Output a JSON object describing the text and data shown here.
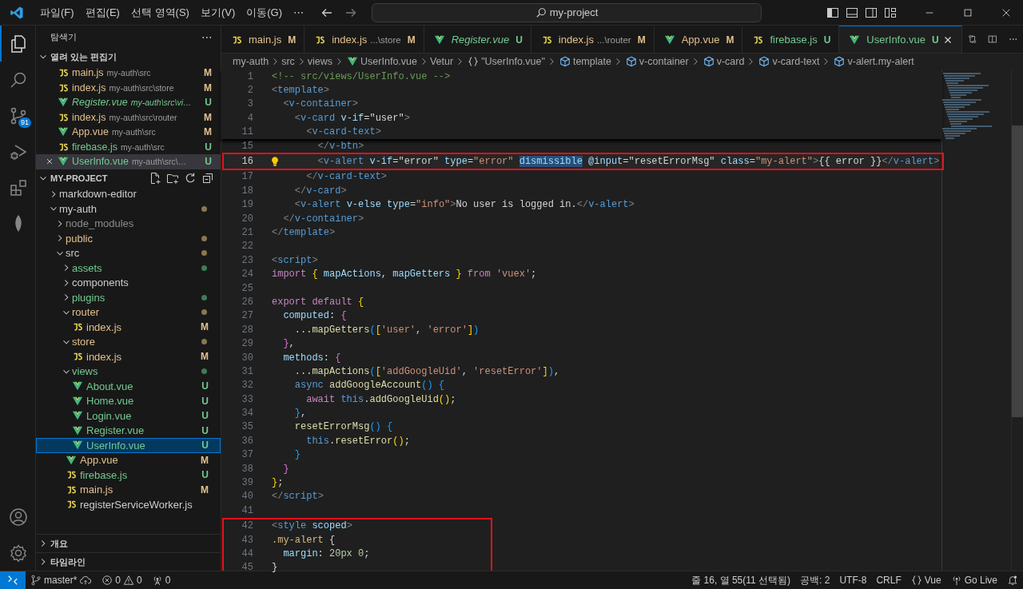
{
  "title_bar": {
    "menus": [
      "파일(F)",
      "편집(E)",
      "선택 영역(S)",
      "보기(V)",
      "이동(G)",
      "⋯"
    ],
    "search": "my-project"
  },
  "activity_bar": {
    "items": [
      {
        "kind": "files",
        "selected": true
      },
      {
        "kind": "search",
        "selected": false
      },
      {
        "kind": "scm",
        "selected": false,
        "badge": "91"
      },
      {
        "kind": "run",
        "selected": false
      },
      {
        "kind": "extensions",
        "selected": false
      },
      {
        "kind": "leaf",
        "selected": false
      }
    ]
  },
  "sidebar": {
    "title": "탐색기",
    "more": "⋯",
    "open_editors": {
      "title": "열려 있는 편집기",
      "expanded": true,
      "items": [
        {
          "name": "main.js",
          "path": "my-auth\\src",
          "kind": "js",
          "color": "#e2c08d",
          "status": "M",
          "preview": false,
          "selected": false
        },
        {
          "name": "index.js",
          "path": "my-auth\\src\\store",
          "kind": "js",
          "color": "#e2c08d",
          "status": "M",
          "preview": false,
          "selected": false
        },
        {
          "name": "Register.vue",
          "path": "my-auth\\src\\vi…",
          "kind": "vue",
          "color": "#73c991",
          "status": "U",
          "preview": true,
          "selected": false
        },
        {
          "name": "index.js",
          "path": "my-auth\\src\\router",
          "kind": "js",
          "color": "#e2c08d",
          "status": "M",
          "preview": false,
          "selected": false
        },
        {
          "name": "App.vue",
          "path": "my-auth\\src",
          "kind": "vue",
          "color": "#e2c08d",
          "status": "M",
          "preview": false,
          "selected": false
        },
        {
          "name": "firebase.js",
          "path": "my-auth\\src",
          "kind": "js",
          "color": "#73c991",
          "status": "U",
          "preview": false,
          "selected": false
        },
        {
          "name": "UserInfo.vue",
          "path": "my-auth\\src\\…",
          "kind": "vue",
          "color": "#73c991",
          "status": "U",
          "preview": false,
          "selected": true
        }
      ]
    },
    "project": {
      "title": "MY-PROJECT",
      "expanded": true,
      "items": [
        {
          "name": "markdown-editor",
          "kind": "folder",
          "expanded": false,
          "selected": false
        },
        {
          "name": "my-auth",
          "kind": "folder",
          "expanded": true,
          "selected": false,
          "dot": {
            "color": "#8a7650"
          },
          "children": [
            {
              "name": "node_modules",
              "kind": "folder",
              "color": "#8c8c8c",
              "expanded": false,
              "selected": false
            },
            {
              "name": "public",
              "kind": "folder",
              "color": "#e2c08d",
              "expanded": false,
              "selected": false,
              "dot": {
                "color": "#8a7650"
              }
            },
            {
              "name": "src",
              "kind": "folder",
              "expanded": true,
              "selected": false,
              "dot": {
                "color": "#8a7650"
              },
              "children": [
                {
                  "name": "assets",
                  "kind": "folder",
                  "color": "#73c991",
                  "expanded": false,
                  "selected": false,
                  "dot": {
                    "color": "#3f7a55"
                  }
                },
                {
                  "name": "components",
                  "kind": "folder",
                  "expanded": false,
                  "selected": false
                },
                {
                  "name": "plugins",
                  "kind": "folder",
                  "color": "#73c991",
                  "expanded": false,
                  "selected": false,
                  "dot": {
                    "color": "#3f7a55"
                  }
                },
                {
                  "name": "router",
                  "kind": "folder",
                  "color": "#e2c08d",
                  "expanded": true,
                  "selected": false,
                  "dot": {
                    "color": "#8a7650"
                  },
                  "children": [
                    {
                      "name": "index.js",
                      "kind": "js",
                      "color": "#e2c08d",
                      "status": "M",
                      "selected": false
                    }
                  ]
                },
                {
                  "name": "store",
                  "kind": "folder",
                  "color": "#e2c08d",
                  "expanded": true,
                  "selected": false,
                  "dot": {
                    "color": "#8a7650"
                  },
                  "children": [
                    {
                      "name": "index.js",
                      "kind": "js",
                      "color": "#e2c08d",
                      "status": "M",
                      "selected": false
                    }
                  ]
                },
                {
                  "name": "views",
                  "kind": "folder",
                  "color": "#73c991",
                  "expanded": true,
                  "selected": false,
                  "dot": {
                    "color": "#3f7a55"
                  },
                  "children": [
                    {
                      "name": "About.vue",
                      "kind": "vue",
                      "color": "#73c991",
                      "status": "U",
                      "selected": false
                    },
                    {
                      "name": "Home.vue",
                      "kind": "vue",
                      "color": "#73c991",
                      "status": "U",
                      "selected": false
                    },
                    {
                      "name": "Login.vue",
                      "kind": "vue",
                      "color": "#73c991",
                      "status": "U",
                      "selected": false
                    },
                    {
                      "name": "Register.vue",
                      "kind": "vue",
                      "color": "#73c991",
                      "status": "U",
                      "selected": false
                    },
                    {
                      "name": "UserInfo.vue",
                      "kind": "vue",
                      "color": "#73c991",
                      "status": "U",
                      "selected": true
                    }
                  ]
                },
                {
                  "name": "App.vue",
                  "kind": "vue",
                  "color": "#e2c08d",
                  "status": "M",
                  "selected": false
                },
                {
                  "name": "firebase.js",
                  "kind": "js",
                  "color": "#73c991",
                  "status": "U",
                  "selected": false
                },
                {
                  "name": "main.js",
                  "kind": "js",
                  "color": "#e2c08d",
                  "status": "M",
                  "selected": false
                },
                {
                  "name": "registerServiceWorker.js",
                  "kind": "js",
                  "selected": false
                }
              ]
            }
          ]
        }
      ]
    },
    "sections": [
      {
        "title": "개요",
        "expanded": false
      },
      {
        "title": "타임라인",
        "expanded": false
      }
    ]
  },
  "tabs": [
    {
      "name": "main.js",
      "kind": "js",
      "color": "#e2c08d",
      "status": "M",
      "preview": false,
      "selected": false
    },
    {
      "name": "index.js",
      "desc": "...\\store",
      "kind": "js",
      "color": "#e2c08d",
      "status": "M",
      "preview": false,
      "selected": false
    },
    {
      "name": "Register.vue",
      "kind": "vue",
      "color": "#73c991",
      "status": "U",
      "preview": true,
      "selected": false
    },
    {
      "name": "index.js",
      "desc": "...\\router",
      "kind": "js",
      "color": "#e2c08d",
      "status": "M",
      "preview": false,
      "selected": false
    },
    {
      "name": "App.vue",
      "kind": "vue",
      "color": "#e2c08d",
      "status": "M",
      "preview": false,
      "selected": false
    },
    {
      "name": "firebase.js",
      "kind": "js",
      "color": "#73c991",
      "status": "U",
      "preview": false,
      "selected": false
    },
    {
      "name": "UserInfo.vue",
      "kind": "vue",
      "color": "#73c991",
      "status": "U",
      "preview": false,
      "selected": true
    }
  ],
  "breadcrumbs": [
    {
      "label": "my-auth",
      "kind": "plain"
    },
    {
      "label": "src",
      "kind": "plain"
    },
    {
      "label": "views",
      "kind": "plain"
    },
    {
      "label": "UserInfo.vue",
      "kind": "vue"
    },
    {
      "label": "Vetur",
      "kind": "plain"
    },
    {
      "label": "\"UserInfo.vue\"",
      "kind": "braces"
    },
    {
      "label": "template",
      "kind": "cube"
    },
    {
      "label": "v-container",
      "kind": "cube"
    },
    {
      "label": "v-card",
      "kind": "cube"
    },
    {
      "label": "v-card-text",
      "kind": "cube"
    },
    {
      "label": "v-alert.my-alert",
      "kind": "cube"
    }
  ],
  "sticky_lines": [
    {
      "num": "1",
      "tokens": [
        {
          "kind": "c",
          "t": "<!-- src/views/UserInfo.vue -->"
        }
      ]
    },
    {
      "num": "2",
      "tokens": [
        {
          "kind": "p",
          "t": "<"
        },
        {
          "kind": "t",
          "t": "template"
        },
        {
          "kind": "p",
          "t": ">"
        }
      ]
    },
    {
      "num": "3",
      "tokens": [
        {
          "kind": "p",
          "t": "  <"
        },
        {
          "kind": "t",
          "t": "v-container"
        },
        {
          "kind": "p",
          "t": ">"
        }
      ]
    },
    {
      "num": "4",
      "tokens": [
        {
          "kind": "p",
          "t": "    <"
        },
        {
          "kind": "t",
          "t": "v-card"
        },
        {
          "kind": "a",
          "t": " v-if"
        },
        {
          "kind": "x",
          "t": "=\"user\""
        },
        {
          "kind": "p",
          "t": ">"
        }
      ]
    },
    {
      "num": "11",
      "tokens": [
        {
          "kind": "p",
          "t": "      <"
        },
        {
          "kind": "t",
          "t": "v-card-text"
        },
        {
          "kind": "p",
          "t": ">"
        }
      ]
    }
  ],
  "lines": [
    {
      "num": "15",
      "current": false,
      "boxed": false,
      "tokens": [
        {
          "kind": "p",
          "t": "        </"
        },
        {
          "kind": "t",
          "t": "v-btn"
        },
        {
          "kind": "p",
          "t": ">"
        }
      ]
    },
    {
      "num": "16",
      "current": true,
      "boxed": true,
      "tokens": [
        {
          "kind": "p",
          "t": "        <"
        },
        {
          "kind": "t",
          "t": "v-alert"
        },
        {
          "kind": "a",
          "t": " v-if"
        },
        {
          "kind": "x",
          "t": "=\"error\""
        },
        {
          "kind": "a",
          "t": " type"
        },
        {
          "kind": "x",
          "t": "="
        },
        {
          "kind": "s",
          "t": "\"error\" "
        },
        {
          "kind": "sel",
          "t": "dismissible"
        },
        {
          "kind": "a",
          "t": " @input"
        },
        {
          "kind": "x",
          "t": "=\"resetErrorMsg\""
        },
        {
          "kind": "a",
          "t": " class"
        },
        {
          "kind": "x",
          "t": "="
        },
        {
          "kind": "s",
          "t": "\"my-alert\""
        },
        {
          "kind": "p",
          "t": ">"
        },
        {
          "kind": "x",
          "t": "{{ error }}"
        },
        {
          "kind": "p",
          "t": "</"
        },
        {
          "kind": "t",
          "t": "v-alert"
        },
        {
          "kind": "p",
          "t": ">"
        }
      ]
    },
    {
      "num": "17",
      "current": false,
      "boxed": false,
      "tokens": [
        {
          "kind": "p",
          "t": "      </"
        },
        {
          "kind": "t",
          "t": "v-card-text"
        },
        {
          "kind": "p",
          "t": ">"
        }
      ]
    },
    {
      "num": "18",
      "current": false,
      "boxed": false,
      "tokens": [
        {
          "kind": "p",
          "t": "    </"
        },
        {
          "kind": "t",
          "t": "v-card"
        },
        {
          "kind": "p",
          "t": ">"
        }
      ]
    },
    {
      "num": "19",
      "current": false,
      "boxed": false,
      "tokens": [
        {
          "kind": "p",
          "t": "    <"
        },
        {
          "kind": "t",
          "t": "v-alert"
        },
        {
          "kind": "a",
          "t": " v-else"
        },
        {
          "kind": "a",
          "t": " type"
        },
        {
          "kind": "x",
          "t": "="
        },
        {
          "kind": "s",
          "t": "\"info\""
        },
        {
          "kind": "p",
          "t": ">"
        },
        {
          "kind": "x",
          "t": "No user is logged in."
        },
        {
          "kind": "p",
          "t": "</"
        },
        {
          "kind": "t",
          "t": "v-alert"
        },
        {
          "kind": "p",
          "t": ">"
        }
      ]
    },
    {
      "num": "20",
      "current": false,
      "boxed": false,
      "tokens": [
        {
          "kind": "p",
          "t": "  </"
        },
        {
          "kind": "t",
          "t": "v-container"
        },
        {
          "kind": "p",
          "t": ">"
        }
      ]
    },
    {
      "num": "21",
      "current": false,
      "boxed": false,
      "tokens": [
        {
          "kind": "p",
          "t": "</"
        },
        {
          "kind": "t",
          "t": "template"
        },
        {
          "kind": "p",
          "t": ">"
        }
      ]
    },
    {
      "num": "22",
      "current": false,
      "boxed": false
    },
    {
      "num": "23",
      "current": false,
      "boxed": false,
      "tokens": [
        {
          "kind": "p",
          "t": "<"
        },
        {
          "kind": "t",
          "t": "script"
        },
        {
          "kind": "p",
          "t": ">"
        }
      ]
    },
    {
      "num": "24",
      "current": false,
      "boxed": false,
      "tokens": [
        {
          "kind": "k",
          "t": "import"
        },
        {
          "kind": "y",
          "t": " { "
        },
        {
          "kind": "v",
          "t": "mapActions"
        },
        {
          "kind": "x",
          "t": ", "
        },
        {
          "kind": "v",
          "t": "mapGetters"
        },
        {
          "kind": "y",
          "t": " }"
        },
        {
          "kind": "k",
          "t": " from"
        },
        {
          "kind": "s",
          "t": " 'vuex'"
        },
        {
          "kind": "x",
          "t": ";"
        }
      ]
    },
    {
      "num": "25",
      "current": false,
      "boxed": false
    },
    {
      "num": "26",
      "current": false,
      "boxed": false,
      "tokens": [
        {
          "kind": "k",
          "t": "export default"
        },
        {
          "kind": "y",
          "t": " {"
        }
      ]
    },
    {
      "num": "27",
      "current": false,
      "boxed": false,
      "tokens": [
        {
          "kind": "v",
          "t": "  computed"
        },
        {
          "kind": "x",
          "t": ": "
        },
        {
          "kind": "m",
          "t": "{"
        }
      ]
    },
    {
      "num": "28",
      "current": false,
      "boxed": false,
      "tokens": [
        {
          "kind": "x",
          "t": "    ..."
        },
        {
          "kind": "f",
          "t": "mapGetters"
        },
        {
          "kind": "l",
          "t": "("
        },
        {
          "kind": "y",
          "t": "["
        },
        {
          "kind": "s",
          "t": "'user'"
        },
        {
          "kind": "x",
          "t": ", "
        },
        {
          "kind": "s",
          "t": "'error'"
        },
        {
          "kind": "y",
          "t": "]"
        },
        {
          "kind": "l",
          "t": ")"
        }
      ]
    },
    {
      "num": "29",
      "current": false,
      "boxed": false,
      "tokens": [
        {
          "kind": "m",
          "t": "  }"
        },
        {
          "kind": "x",
          "t": ","
        }
      ]
    },
    {
      "num": "30",
      "current": false,
      "boxed": false,
      "tokens": [
        {
          "kind": "v",
          "t": "  methods"
        },
        {
          "kind": "x",
          "t": ": "
        },
        {
          "kind": "m",
          "t": "{"
        }
      ]
    },
    {
      "num": "31",
      "current": false,
      "boxed": false,
      "tokens": [
        {
          "kind": "x",
          "t": "    ..."
        },
        {
          "kind": "f",
          "t": "mapActions"
        },
        {
          "kind": "l",
          "t": "("
        },
        {
          "kind": "y",
          "t": "["
        },
        {
          "kind": "s",
          "t": "'addGoogleUid'"
        },
        {
          "kind": "x",
          "t": ", "
        },
        {
          "kind": "s",
          "t": "'resetError'"
        },
        {
          "kind": "y",
          "t": "]"
        },
        {
          "kind": "l",
          "t": ")"
        },
        {
          "kind": "x",
          "t": ","
        }
      ]
    },
    {
      "num": "32",
      "current": false,
      "boxed": false,
      "tokens": [
        {
          "kind": "b",
          "t": "    async"
        },
        {
          "kind": "f",
          "t": " addGoogleAccount"
        },
        {
          "kind": "l",
          "t": "() {"
        }
      ]
    },
    {
      "num": "33",
      "current": false,
      "boxed": false,
      "tokens": [
        {
          "kind": "k",
          "t": "      await"
        },
        {
          "kind": "b",
          "t": " this"
        },
        {
          "kind": "x",
          "t": "."
        },
        {
          "kind": "f",
          "t": "addGoogleUid"
        },
        {
          "kind": "y",
          "t": "()"
        },
        {
          "kind": "x",
          "t": ";"
        }
      ]
    },
    {
      "num": "34",
      "current": false,
      "boxed": false,
      "tokens": [
        {
          "kind": "l",
          "t": "    }"
        },
        {
          "kind": "x",
          "t": ","
        }
      ]
    },
    {
      "num": "35",
      "current": false,
      "boxed": false,
      "tokens": [
        {
          "kind": "f",
          "t": "    resetErrorMsg"
        },
        {
          "kind": "l",
          "t": "() {"
        }
      ]
    },
    {
      "num": "36",
      "current": false,
      "boxed": false,
      "tokens": [
        {
          "kind": "b",
          "t": "      this"
        },
        {
          "kind": "x",
          "t": "."
        },
        {
          "kind": "f",
          "t": "resetError"
        },
        {
          "kind": "y",
          "t": "()"
        },
        {
          "kind": "x",
          "t": ";"
        }
      ]
    },
    {
      "num": "37",
      "current": false,
      "boxed": false,
      "tokens": [
        {
          "kind": "l",
          "t": "    }"
        }
      ]
    },
    {
      "num": "38",
      "current": false,
      "boxed": false,
      "tokens": [
        {
          "kind": "m",
          "t": "  }"
        }
      ]
    },
    {
      "num": "39",
      "current": false,
      "boxed": false,
      "tokens": [
        {
          "kind": "y",
          "t": "}"
        },
        {
          "kind": "x",
          "t": ";"
        }
      ]
    },
    {
      "num": "40",
      "current": false,
      "boxed": false,
      "tokens": [
        {
          "kind": "p",
          "t": "</"
        },
        {
          "kind": "t",
          "t": "script"
        },
        {
          "kind": "p",
          "t": ">"
        }
      ]
    },
    {
      "num": "41",
      "current": false,
      "boxed": false
    },
    {
      "num": "42",
      "current": false,
      "boxed": true,
      "tokens": [
        {
          "kind": "p",
          "t": "<"
        },
        {
          "kind": "t",
          "t": "style"
        },
        {
          "kind": "a",
          "t": " scoped"
        },
        {
          "kind": "p",
          "t": ">"
        }
      ]
    },
    {
      "num": "43",
      "current": false,
      "boxed": true,
      "tokens": [
        {
          "kind": "sc",
          "t": ".my-alert"
        },
        {
          "kind": "x",
          "t": " {"
        }
      ]
    },
    {
      "num": "44",
      "current": false,
      "boxed": true,
      "tokens": [
        {
          "kind": "v",
          "t": "  margin"
        },
        {
          "kind": "x",
          "t": ": "
        },
        {
          "kind": "n",
          "t": "20px 0"
        },
        {
          "kind": "x",
          "t": ";"
        }
      ]
    },
    {
      "num": "45",
      "current": false,
      "boxed": true,
      "tokens": [
        {
          "kind": "x",
          "t": "}"
        }
      ]
    }
  ],
  "status_bar": {
    "branch": "master*",
    "errors": "0",
    "warnings": "0",
    "ports": "0",
    "right": [
      {
        "kind": "text",
        "label": "줄 16, 열 55(11 선택됨)"
      },
      {
        "kind": "text",
        "label": "공백: 2"
      },
      {
        "kind": "text",
        "label": "UTF-8"
      },
      {
        "kind": "text",
        "label": "CRLF"
      },
      {
        "kind": "language",
        "label": "Vue"
      },
      {
        "kind": "live",
        "label": "Go Live"
      },
      {
        "kind": "bell"
      }
    ]
  }
}
